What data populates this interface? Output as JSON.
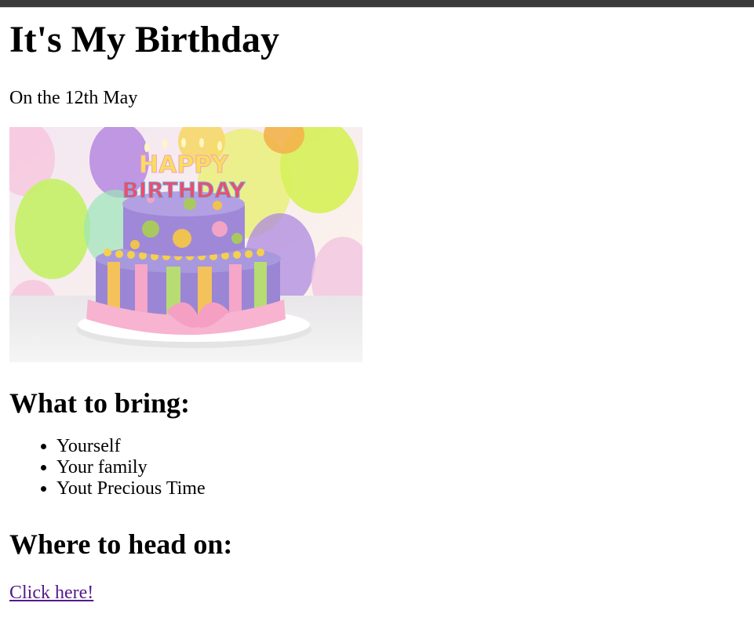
{
  "heading": "It's My Birthday",
  "date": "On the 12th May",
  "image": {
    "cake_text_top": "HAPPY",
    "cake_text_bottom": "BIRTHDAY"
  },
  "bring": {
    "heading": "What to bring:",
    "items": [
      "Yourself",
      "Your family",
      "Yout Precious Time"
    ]
  },
  "where": {
    "heading": "Where to head on:",
    "link_text": "Click here!"
  },
  "colors": {
    "link_visited": "#551a8b",
    "topbar": "#3a3a3a"
  }
}
